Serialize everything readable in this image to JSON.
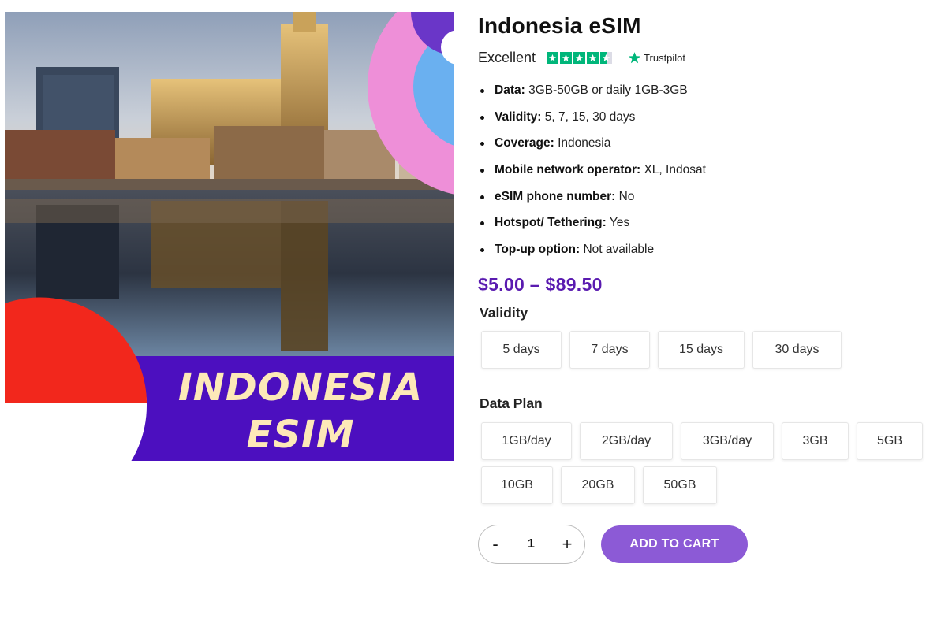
{
  "product": {
    "image_title_line1": "INDONESIA",
    "image_title_line2": "ESIM",
    "title": "Indonesia eSIM",
    "rating_label": "Excellent",
    "rating_stars": 4.5,
    "trustpilot_label": "Trustpilot",
    "trustpilot_color": "#00b67a",
    "features": [
      {
        "key": "Data:",
        "value": "3GB-50GB or daily 1GB-3GB"
      },
      {
        "key": "Validity:",
        "value": "5, 7, 15, 30 days"
      },
      {
        "key": "Coverage:",
        "value": "Indonesia"
      },
      {
        "key": "Mobile network operator:",
        "value": "XL, Indosat"
      },
      {
        "key": "eSIM phone number:",
        "value": "No"
      },
      {
        "key": "Hotspot/ Tethering:",
        "value": "Yes"
      },
      {
        "key": "Top-up option:",
        "value": "Not available"
      }
    ],
    "price": "$5.00 – $89.50",
    "price_color": "#5a1bb0"
  },
  "validity": {
    "label": "Validity",
    "options": [
      "5 days",
      "7 days",
      "15 days",
      "30 days"
    ]
  },
  "data_plan": {
    "label": "Data Plan",
    "options": [
      "1GB/day",
      "2GB/day",
      "3GB/day",
      "3GB",
      "5GB",
      "10GB",
      "20GB",
      "50GB"
    ]
  },
  "cart": {
    "minus_label": "-",
    "quantity": "1",
    "plus_label": "+",
    "add_to_cart_label": "ADD TO CART",
    "button_color": "#8c5ad6"
  }
}
